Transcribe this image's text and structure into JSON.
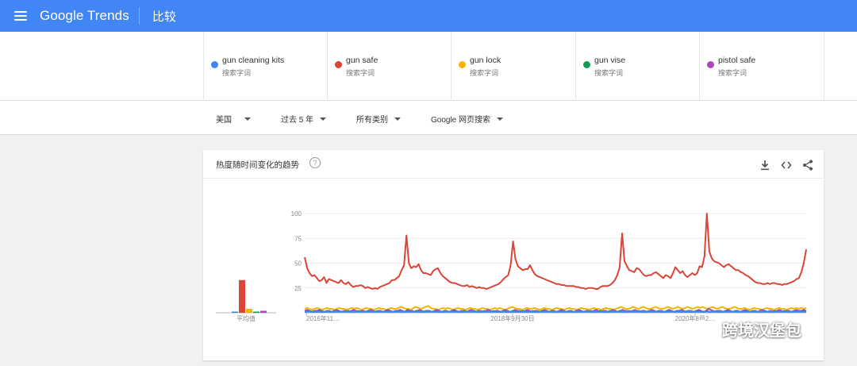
{
  "header": {
    "app_name": "Google Trends",
    "page_title": "比较"
  },
  "terms": [
    {
      "name": "gun cleaning kits",
      "type": "搜索字词",
      "color": "#4285f4"
    },
    {
      "name": "gun safe",
      "type": "搜索字词",
      "color": "#db4437"
    },
    {
      "name": "gun lock",
      "type": "搜索字词",
      "color": "#f4b400"
    },
    {
      "name": "gun vise",
      "type": "搜索字词",
      "color": "#0f9d58"
    },
    {
      "name": "pistol safe",
      "type": "搜索字词",
      "color": "#ab47bc"
    }
  ],
  "filters": {
    "region": "美国",
    "time": "过去 5 年",
    "category": "所有类别",
    "search_type": "Google 网页搜索"
  },
  "card": {
    "title": "热度随时间变化的趋势",
    "help_symbol": "?"
  },
  "chart_data": {
    "type": "line",
    "ylim": [
      0,
      100
    ],
    "yticks": [
      "25",
      "50",
      "75",
      "100"
    ],
    "xticks": [
      "2016年11…",
      "2018年9月30日",
      "2020年8月2…"
    ],
    "average_label": "平均值",
    "average_values": {
      "gun cleaning kits": 1,
      "gun safe": 33,
      "gun lock": 4,
      "gun vise": 1,
      "pistol safe": 2
    },
    "series": [
      {
        "name": "gun safe",
        "color": "#db4437",
        "values": [
          56,
          45,
          40,
          37,
          38,
          35,
          32,
          33,
          36,
          30,
          34,
          33,
          32,
          31,
          30,
          33,
          30,
          29,
          31,
          28,
          26,
          27,
          27,
          28,
          27,
          25,
          26,
          25,
          24,
          25,
          24,
          26,
          27,
          28,
          29,
          30,
          33,
          33,
          35,
          37,
          43,
          48,
          78,
          50,
          45,
          47,
          46,
          49,
          43,
          40,
          40,
          39,
          38,
          42,
          44,
          45,
          40,
          37,
          35,
          33,
          31,
          30,
          30,
          29,
          28,
          27,
          27,
          28,
          26,
          27,
          26,
          25,
          26,
          25,
          25,
          24,
          25,
          26,
          27,
          28,
          29,
          31,
          34,
          36,
          38,
          48,
          72,
          54,
          47,
          45,
          43,
          44,
          44,
          48,
          43,
          39,
          37,
          36,
          35,
          34,
          33,
          32,
          31,
          30,
          29,
          29,
          28,
          28,
          27,
          27,
          27,
          27,
          26,
          26,
          25,
          25,
          24,
          25,
          25,
          25,
          24,
          24,
          26,
          27,
          27,
          27,
          28,
          30,
          33,
          38,
          46,
          80,
          52,
          47,
          43,
          42,
          41,
          45,
          44,
          41,
          38,
          37,
          38,
          38,
          40,
          41,
          39,
          37,
          35,
          38,
          37,
          35,
          40,
          46,
          43,
          40,
          42,
          38,
          36,
          38,
          40,
          38,
          40,
          47,
          46,
          57,
          100,
          62,
          55,
          52,
          51,
          50,
          48,
          46,
          48,
          49,
          47,
          45,
          43,
          43,
          41,
          40,
          38,
          37,
          35,
          33,
          31,
          30,
          30,
          29,
          29,
          30,
          29,
          30,
          30,
          29,
          29,
          28,
          29,
          29,
          30,
          31,
          32,
          34,
          35,
          41,
          50,
          64
        ]
      },
      {
        "name": "gun lock",
        "color": "#f4b400",
        "values": [
          4,
          5,
          4,
          3,
          4,
          5,
          4,
          3,
          4,
          5,
          4,
          4,
          3,
          4,
          5,
          4,
          4,
          3,
          4,
          5,
          4,
          5,
          4,
          3,
          4,
          5,
          4,
          4,
          3,
          4,
          5,
          4,
          4,
          3,
          4,
          5,
          4,
          4,
          5,
          6,
          5,
          4,
          4,
          3,
          5,
          6,
          5,
          4,
          5,
          6,
          7,
          5,
          4,
          4,
          3,
          4,
          5,
          4,
          5,
          4,
          3,
          4,
          5,
          4,
          4,
          3,
          4,
          5,
          4,
          4,
          3,
          4,
          5,
          4,
          4,
          3,
          4,
          5,
          4,
          5,
          4,
          3,
          4,
          5,
          6,
          5,
          4,
          4,
          3,
          4,
          5,
          4,
          4,
          5,
          4,
          3,
          4,
          5,
          4,
          4,
          3,
          4,
          5,
          4,
          4,
          3,
          4,
          5,
          4,
          4,
          3,
          4,
          5,
          4,
          4,
          3,
          4,
          5,
          4,
          4,
          3,
          4,
          5,
          4,
          4,
          3,
          4,
          5,
          6,
          5,
          4,
          4,
          5,
          6,
          5,
          4,
          5,
          6,
          5,
          4,
          4,
          5,
          6,
          5,
          4,
          4,
          5,
          6,
          5,
          4,
          5,
          6,
          5,
          4,
          5,
          6,
          5,
          4,
          5,
          6,
          5,
          6,
          5,
          4,
          5,
          6,
          5,
          4,
          5,
          6,
          5,
          4,
          4,
          5,
          6,
          5,
          4,
          4,
          5,
          4,
          3,
          4,
          5,
          4,
          4,
          3,
          4,
          5,
          4,
          4,
          3,
          4,
          5,
          4,
          4,
          3,
          4,
          5,
          4,
          5,
          4,
          5,
          4,
          5
        ]
      },
      {
        "name": "pistol safe",
        "color": "#ab47bc",
        "values": [
          2,
          3,
          2,
          1,
          2,
          2,
          3,
          2,
          1,
          2,
          2,
          1,
          2,
          3,
          2,
          1,
          2,
          2,
          1,
          2,
          3,
          2,
          1,
          2,
          2,
          1,
          2,
          3,
          2,
          1,
          2,
          2,
          1,
          2,
          3,
          2,
          1,
          2,
          2,
          3,
          2,
          1,
          3,
          2,
          2,
          1,
          2,
          3,
          2,
          1,
          2,
          2,
          1,
          2,
          3,
          2,
          1,
          2,
          2,
          1,
          2,
          3,
          2,
          1,
          2,
          2,
          1,
          2,
          3,
          2,
          1,
          2,
          2,
          1,
          2,
          3,
          2,
          1,
          2,
          2,
          1,
          2,
          3,
          2,
          1,
          2,
          3,
          2,
          2,
          1,
          2,
          3,
          2,
          1,
          2,
          2,
          1,
          2,
          3,
          2,
          1,
          2,
          2,
          1,
          2,
          3,
          2,
          1,
          2,
          2,
          1,
          2,
          3,
          2,
          1,
          2,
          2,
          1,
          2,
          3,
          2,
          1,
          2,
          2,
          1,
          2,
          3,
          2,
          1,
          2,
          3,
          2,
          2,
          1,
          2,
          3,
          2,
          1,
          2,
          2,
          1,
          2,
          3,
          2,
          1,
          2,
          2,
          1,
          2,
          3,
          2,
          1,
          2,
          2,
          3,
          2,
          1,
          2,
          2,
          1,
          2,
          3,
          2,
          1,
          2,
          4,
          3,
          2,
          1,
          2,
          2,
          1,
          2,
          3,
          2,
          1,
          2,
          2,
          1,
          2,
          3,
          2,
          1,
          2,
          2,
          1,
          2,
          3,
          2,
          1,
          2,
          2,
          1,
          2,
          3,
          2,
          1,
          2,
          2,
          1,
          2,
          3,
          2,
          2,
          3,
          2
        ]
      },
      {
        "name": "gun vise",
        "color": "#0f9d58",
        "values": [
          1,
          1,
          2,
          1,
          1,
          1,
          2,
          1,
          1,
          1,
          2,
          1,
          1,
          1,
          2,
          1,
          1,
          1,
          2,
          1,
          1,
          1,
          2,
          1,
          1,
          1,
          2,
          1,
          1,
          1,
          2,
          1,
          1,
          1,
          2,
          1,
          1,
          1,
          2,
          1,
          1,
          1,
          2,
          1,
          1,
          1,
          2,
          1,
          1,
          1,
          2,
          1,
          1,
          1,
          2,
          1,
          1,
          1,
          2,
          1,
          1,
          1,
          2,
          1,
          1,
          1,
          2,
          1,
          1,
          1,
          2,
          1,
          1,
          1,
          2,
          1,
          1,
          1,
          2,
          1,
          1,
          1,
          2,
          1,
          1,
          1,
          2,
          1,
          1,
          1,
          2,
          1,
          1,
          1,
          2,
          1,
          1,
          1,
          2,
          1,
          1,
          1,
          2,
          1,
          1,
          1,
          2,
          1,
          1,
          1,
          2,
          1,
          1,
          1,
          2,
          1,
          1,
          1,
          2,
          1,
          1,
          1,
          2,
          1,
          1,
          1,
          2,
          1,
          1,
          1,
          2,
          1,
          1,
          1,
          2,
          1,
          1,
          1,
          2,
          1,
          1,
          1,
          2,
          1,
          1,
          1,
          2,
          1,
          1,
          1,
          2,
          1,
          1,
          1,
          2,
          1,
          1,
          1,
          2,
          1,
          1,
          1,
          2,
          1,
          1,
          1,
          2,
          1,
          1,
          1,
          2,
          1,
          1,
          1,
          2,
          1,
          1,
          1,
          2,
          1,
          1,
          1,
          2,
          1,
          1,
          1,
          2,
          1,
          1,
          1,
          2,
          1,
          1,
          1,
          2,
          1,
          1,
          1,
          2,
          1,
          1,
          1,
          2,
          1,
          1,
          1,
          2,
          1
        ]
      },
      {
        "name": "gun cleaning kits",
        "color": "#4285f4",
        "values": [
          1,
          1,
          1,
          1,
          1,
          1,
          1,
          1,
          1,
          1,
          1,
          1,
          1,
          1,
          1,
          1,
          1,
          1,
          1,
          1,
          1,
          1,
          1,
          1,
          1,
          1,
          1,
          1,
          1,
          1,
          1,
          1,
          1,
          1,
          1,
          1,
          1,
          1,
          1,
          1,
          1,
          1,
          1,
          1,
          1,
          1,
          1,
          1,
          1,
          1,
          1,
          1,
          1,
          1,
          1,
          1,
          1,
          1,
          1,
          1,
          1,
          1,
          1,
          1,
          1,
          1,
          1,
          1,
          1,
          1,
          1,
          1,
          1,
          1,
          1,
          1,
          1,
          1,
          1,
          1,
          1,
          1,
          1,
          1,
          1,
          1,
          1,
          1,
          1,
          1,
          1,
          1,
          1,
          1,
          1,
          1,
          1,
          1,
          1,
          1,
          1,
          1,
          1,
          1,
          1,
          1,
          1,
          1,
          1,
          1,
          1,
          1,
          1,
          1,
          1,
          1,
          1,
          1,
          1,
          1,
          1,
          1,
          1,
          1,
          1,
          1,
          1,
          1,
          1,
          1,
          1,
          1,
          1,
          1,
          1,
          1,
          1,
          1,
          1,
          1,
          1,
          1,
          1,
          1,
          1,
          1,
          1,
          1,
          1,
          1,
          1,
          1,
          1,
          1,
          1,
          1,
          1,
          1,
          1,
          1,
          1,
          1,
          1,
          1,
          1,
          1,
          1,
          1,
          1,
          1,
          1,
          1,
          1,
          1,
          1,
          1,
          1,
          1,
          1,
          1,
          1,
          1,
          1,
          1,
          1,
          1,
          1,
          1,
          1,
          1,
          1,
          1,
          1,
          1,
          1,
          1,
          1,
          1,
          1,
          1,
          1,
          1,
          1,
          1,
          1,
          1,
          1,
          1
        ]
      }
    ]
  },
  "watermark": {
    "text": "跨境汉堡包"
  }
}
